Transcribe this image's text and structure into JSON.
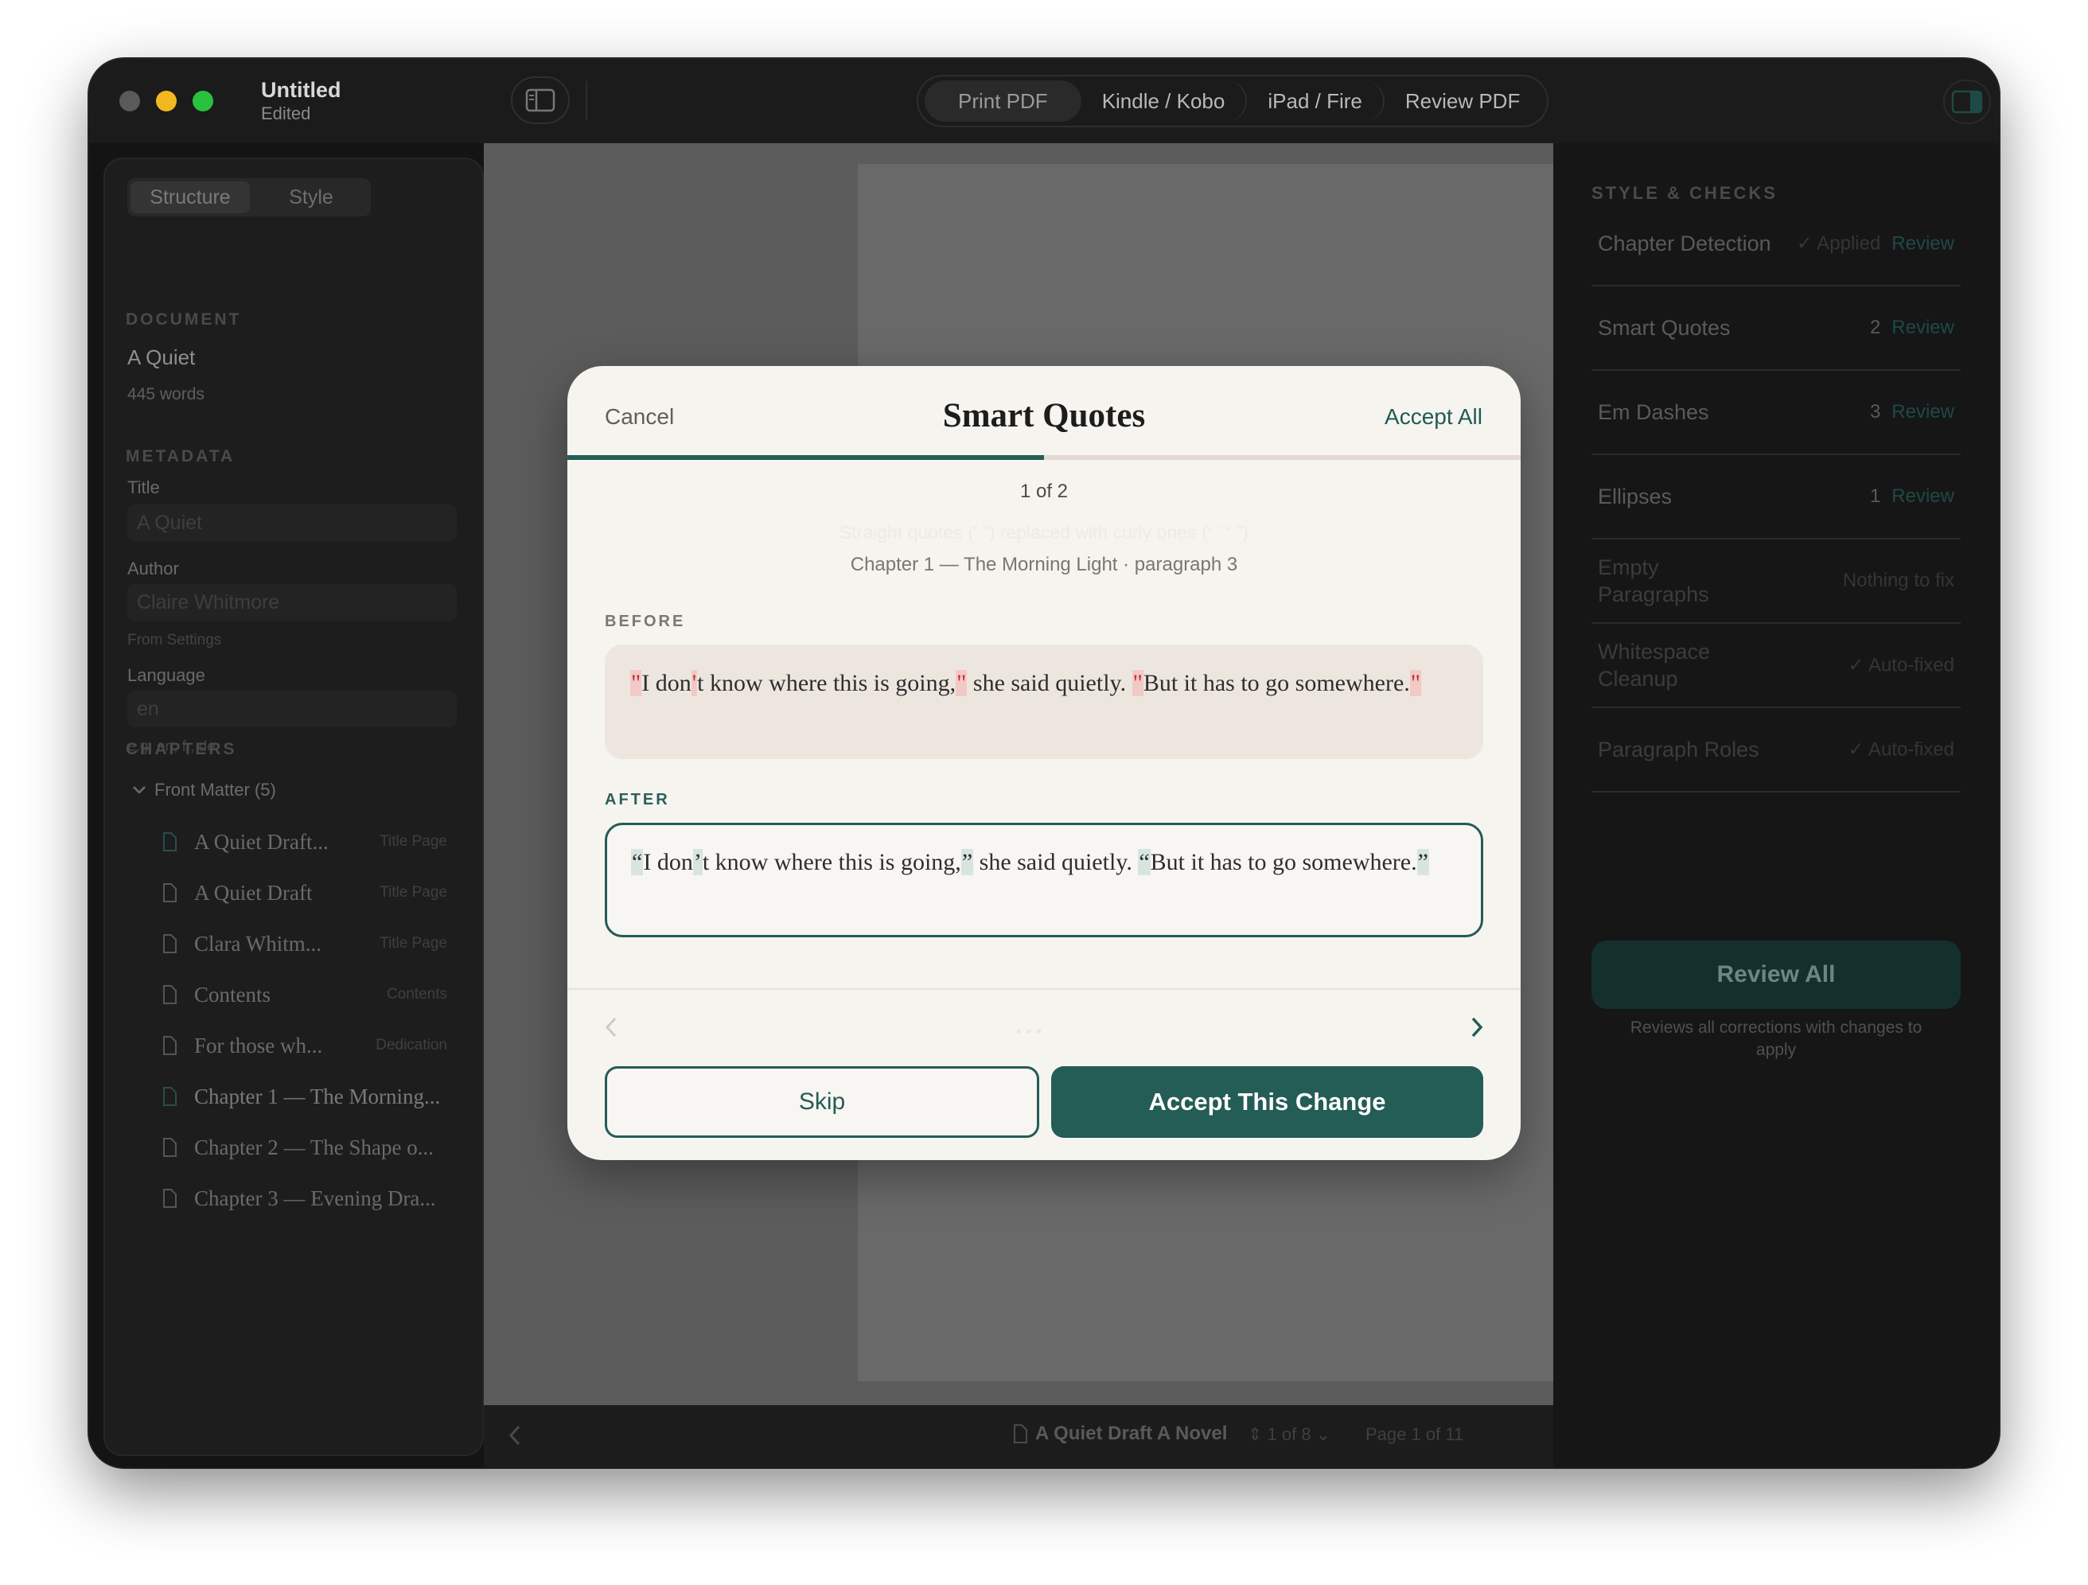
{
  "window": {
    "title": "Untitled",
    "subtitle": "Edited"
  },
  "toolbar": {
    "tabs": [
      "Print PDF",
      "Kindle / Kobo",
      "iPad / Fire",
      "Review PDF"
    ],
    "active_tab": "Print PDF"
  },
  "sidebar": {
    "tabs": [
      "Structure",
      "Style"
    ],
    "document_label": "DOCUMENT",
    "document_name": "A Quiet",
    "word_count": "445 words",
    "metadata_label": "METADATA",
    "title_label": "Title",
    "title_placeholder": "A Quiet",
    "author_label": "Author",
    "author_placeholder": "Claire Whitmore",
    "author_hint": "From Settings",
    "language_label": "Language",
    "language_placeholder": "en",
    "language_hint": "e.g. en, fr, de",
    "chapters_label": "CHAPTERS",
    "front_matter": "Front Matter (5)",
    "chapters": [
      {
        "name": "A Quiet Draft...",
        "type": "Title Page"
      },
      {
        "name": "A Quiet Draft",
        "type": "Title Page"
      },
      {
        "name": "Clara Whitm...",
        "type": "Title Page"
      },
      {
        "name": "Contents",
        "type": "Contents"
      },
      {
        "name": "For those wh...",
        "type": "Dedication"
      },
      {
        "name": "Chapter 1 — The Morning...",
        "type": ""
      },
      {
        "name": "Chapter 2 — The Shape o...",
        "type": ""
      },
      {
        "name": "Chapter 3 — Evening Dra...",
        "type": ""
      }
    ]
  },
  "bottombar": {
    "book_title": "A Quiet Draft A Novel",
    "chapter_count": "1 of 8",
    "page": "Page 1 of 11"
  },
  "inspector": {
    "title": "STYLE & CHECKS",
    "checks": [
      {
        "name": "Chapter Detection",
        "status": "✓ Applied",
        "action": "Review"
      },
      {
        "name": "Smart Quotes",
        "count": "2",
        "action": "Review"
      },
      {
        "name": "Em Dashes",
        "count": "3",
        "action": "Review"
      },
      {
        "name": "Ellipses",
        "count": "1",
        "action": "Review"
      },
      {
        "name": "Empty Paragraphs",
        "status": "Nothing to fix"
      },
      {
        "name": "Whitespace Cleanup",
        "status": "✓ Auto-fixed"
      },
      {
        "name": "Paragraph Roles",
        "status": "✓ Auto-fixed"
      }
    ],
    "review_all": "Review All",
    "review_note": "Reviews all corrections with changes to apply"
  },
  "modal": {
    "cancel": "Cancel",
    "title": "Smart Quotes",
    "accept_all": "Accept All",
    "progress": 0.5,
    "counter": "1 of 2",
    "ghost_text": "Straight quotes (' \") replaced with curly ones (‘ ’ “ ”)",
    "location": "Chapter 1 — The Morning Light · paragraph 3",
    "before_label": "BEFORE",
    "after_label": "AFTER",
    "before": {
      "q1": "\"",
      "t1": "I don",
      "q2": "'",
      "t2": "t know where this is going,",
      "q3": "\"",
      "t3": " she said quietly. ",
      "q4": "\"",
      "t4": "But it has to go somewhere.",
      "q5": "\""
    },
    "after": {
      "q1": "“",
      "t1": "I don",
      "q2": "’",
      "t2": "t know where this is going,",
      "q3": "”",
      "t3": " she said quietly. ",
      "q4": "“",
      "t4": "But it has to go somewhere.",
      "q5": "”"
    },
    "skip": "Skip",
    "accept": "Accept This Change"
  },
  "colors": {
    "accent": "#245c56",
    "accent_dark": "#13302d",
    "highlight_before": "#f2c9c6",
    "highlight_after": "#d7e4e0"
  }
}
